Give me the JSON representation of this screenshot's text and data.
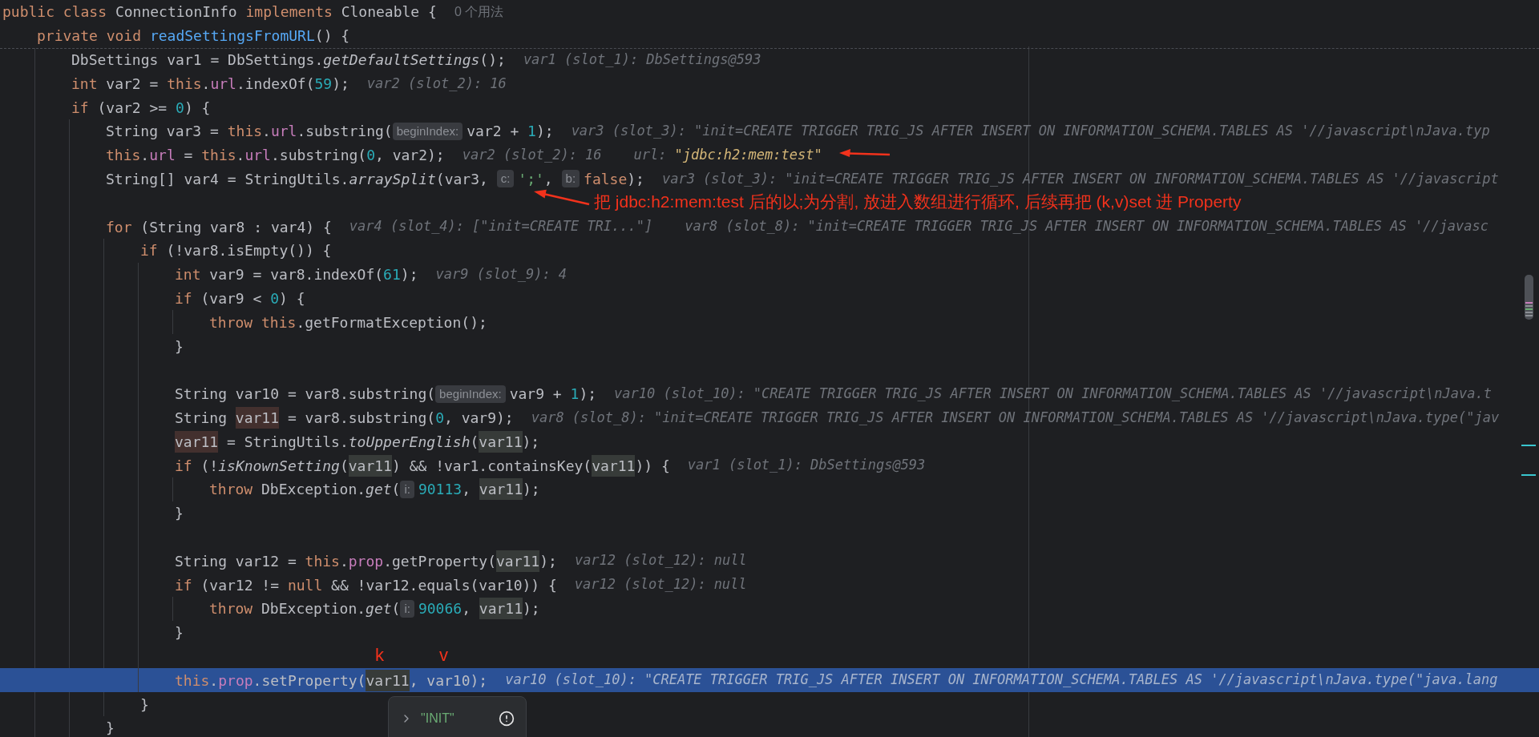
{
  "code": {
    "lines": [
      {
        "selected": false,
        "usages": "0 个用法",
        "tokens": [
          {
            "kind": "k",
            "text": "public class "
          },
          {
            "kind": "p",
            "text": "ConnectionInfo "
          },
          {
            "kind": "k",
            "text": "implements "
          },
          {
            "kind": "p",
            "text": "Cloneable {"
          }
        ],
        "children": [
          {
            "selected": false,
            "tokens": [
              {
                "kind": "k",
                "text": "private void "
              },
              {
                "kind": "d",
                "text": "readSettingsFromURL"
              },
              {
                "kind": "p",
                "text": "() {"
              }
            ],
            "children": [
              {
                "selected": false,
                "tokens": [
                  {
                    "kind": "p",
                    "text": "DbSettings var1 = DbSettings."
                  },
                  {
                    "kind": "i",
                    "text": "getDefaultSettings"
                  },
                  {
                    "kind": "p",
                    "text": "();"
                  }
                ],
                "values": [
                  {
                    "label": "var1 (slot_1):",
                    "value": "DbSettings@593",
                    "changed": false
                  }
                ]
              },
              {
                "selected": false,
                "tokens": [
                  {
                    "kind": "k",
                    "text": "int "
                  },
                  {
                    "kind": "p",
                    "text": "var2 = "
                  },
                  {
                    "kind": "k",
                    "text": "this"
                  },
                  {
                    "kind": "p",
                    "text": "."
                  },
                  {
                    "kind": "f",
                    "text": "url"
                  },
                  {
                    "kind": "p",
                    "text": ".indexOf("
                  },
                  {
                    "kind": "n",
                    "text": "59"
                  },
                  {
                    "kind": "p",
                    "text": ");"
                  }
                ],
                "values": [
                  {
                    "label": "var2 (slot_2):",
                    "value": "16",
                    "changed": false
                  }
                ]
              },
              {
                "selected": false,
                "tokens": [
                  {
                    "kind": "k",
                    "text": "if "
                  },
                  {
                    "kind": "p",
                    "text": "(var2 >= "
                  },
                  {
                    "kind": "n",
                    "text": "0"
                  },
                  {
                    "kind": "p",
                    "text": ") {"
                  }
                ],
                "children": [
                  {
                    "selected": false,
                    "tokens": [
                      {
                        "kind": "p",
                        "text": "String var3 = "
                      },
                      {
                        "kind": "k",
                        "text": "this"
                      },
                      {
                        "kind": "p",
                        "text": "."
                      },
                      {
                        "kind": "f",
                        "text": "url"
                      },
                      {
                        "kind": "p",
                        "text": ".substring("
                      },
                      {
                        "kind": "h",
                        "text": "beginIndex:"
                      },
                      {
                        "kind": "p",
                        "text": "var2 + "
                      },
                      {
                        "kind": "n",
                        "text": "1"
                      },
                      {
                        "kind": "p",
                        "text": ");"
                      }
                    ],
                    "values": [
                      {
                        "label": "var3 (slot_3):",
                        "value": "\"init=CREATE TRIGGER TRIG_JS AFTER INSERT ON INFORMATION_SCHEMA.TABLES AS '//javascript\\nJava.typ",
                        "changed": false
                      }
                    ]
                  },
                  {
                    "selected": false,
                    "tokens": [
                      {
                        "kind": "k",
                        "text": "this"
                      },
                      {
                        "kind": "p",
                        "text": "."
                      },
                      {
                        "kind": "f",
                        "text": "url"
                      },
                      {
                        "kind": "p",
                        "text": " = "
                      },
                      {
                        "kind": "k",
                        "text": "this"
                      },
                      {
                        "kind": "p",
                        "text": "."
                      },
                      {
                        "kind": "f",
                        "text": "url"
                      },
                      {
                        "kind": "p",
                        "text": ".substring("
                      },
                      {
                        "kind": "n",
                        "text": "0"
                      },
                      {
                        "kind": "p",
                        "text": ", var2);"
                      }
                    ],
                    "values": [
                      {
                        "label": "var2 (slot_2):",
                        "value": "16",
                        "changed": false
                      },
                      {
                        "label": "url:",
                        "value": "\"jdbc:h2:mem:test\"",
                        "changed": true
                      }
                    ]
                  },
                  {
                    "selected": false,
                    "tokens": [
                      {
                        "kind": "p",
                        "text": "String[] var4 = StringUtils."
                      },
                      {
                        "kind": "i",
                        "text": "arraySplit"
                      },
                      {
                        "kind": "p",
                        "text": "(var3, "
                      },
                      {
                        "kind": "h",
                        "text": "c:"
                      },
                      {
                        "kind": "s",
                        "text": "';'"
                      },
                      {
                        "kind": "p",
                        "text": ", "
                      },
                      {
                        "kind": "h",
                        "text": "b:"
                      },
                      {
                        "kind": "k",
                        "text": "false"
                      },
                      {
                        "kind": "p",
                        "text": ");"
                      }
                    ],
                    "values": [
                      {
                        "label": "var3 (slot_3):",
                        "value": "\"init=CREATE TRIGGER TRIG_JS AFTER INSERT ON INFORMATION_SCHEMA.TABLES AS '//javascript",
                        "changed": false
                      }
                    ]
                  },
                  {
                    "selected": false
                  },
                  {
                    "selected": false,
                    "tokens": [
                      {
                        "kind": "k",
                        "text": "for "
                      },
                      {
                        "kind": "p",
                        "text": "(String var8 : var4) {"
                      }
                    ],
                    "values": [
                      {
                        "label": "var4 (slot_4):",
                        "value": "[\"init=CREATE TRI...\"]",
                        "changed": false
                      },
                      {
                        "label": "var8 (slot_8):",
                        "value": "\"init=CREATE TRIGGER TRIG_JS AFTER INSERT ON INFORMATION_SCHEMA.TABLES AS '//javasc",
                        "changed": false
                      }
                    ],
                    "children": [
                      {
                        "selected": false,
                        "tokens": [
                          {
                            "kind": "k",
                            "text": "if "
                          },
                          {
                            "kind": "p",
                            "text": "(!var8.isEmpty()) {"
                          }
                        ],
                        "children": [
                          {
                            "selected": false,
                            "tokens": [
                              {
                                "kind": "k",
                                "text": "int "
                              },
                              {
                                "kind": "p",
                                "text": "var9 = var8.indexOf("
                              },
                              {
                                "kind": "n",
                                "text": "61"
                              },
                              {
                                "kind": "p",
                                "text": ");"
                              }
                            ],
                            "values": [
                              {
                                "label": "var9 (slot_9):",
                                "value": "4",
                                "changed": false
                              }
                            ]
                          },
                          {
                            "selected": false,
                            "tokens": [
                              {
                                "kind": "k",
                                "text": "if "
                              },
                              {
                                "kind": "p",
                                "text": "(var9 < "
                              },
                              {
                                "kind": "n",
                                "text": "0"
                              },
                              {
                                "kind": "p",
                                "text": ") {"
                              }
                            ],
                            "children": [
                              {
                                "selected": false,
                                "tokens": [
                                  {
                                    "kind": "k",
                                    "text": "throw "
                                  },
                                  {
                                    "kind": "k",
                                    "text": "this"
                                  },
                                  {
                                    "kind": "p",
                                    "text": ".getFormatException();"
                                  }
                                ]
                              }
                            ]
                          },
                          {
                            "selected": false,
                            "tokens": [
                              {
                                "kind": "p",
                                "text": "}"
                              }
                            ]
                          },
                          {
                            "selected": false
                          },
                          {
                            "selected": false,
                            "tokens": [
                              {
                                "kind": "p",
                                "text": "String var10 = var8.substring("
                              },
                              {
                                "kind": "h",
                                "text": "beginIndex:"
                              },
                              {
                                "kind": "p",
                                "text": "var9 + "
                              },
                              {
                                "kind": "n",
                                "text": "1"
                              },
                              {
                                "kind": "p",
                                "text": ");"
                              }
                            ],
                            "values": [
                              {
                                "label": "var10 (slot_10):",
                                "value": "\"CREATE TRIGGER TRIG_JS AFTER INSERT ON INFORMATION_SCHEMA.TABLES AS '//javascript\\nJava.t",
                                "changed": false
                              }
                            ]
                          },
                          {
                            "selected": false,
                            "tokens": [
                              {
                                "kind": "p",
                                "text": "String "
                              },
                              {
                                "kind": "w",
                                "text": "var11"
                              },
                              {
                                "kind": "p",
                                "text": " = var8.substring("
                              },
                              {
                                "kind": "n",
                                "text": "0"
                              },
                              {
                                "kind": "p",
                                "text": ", var9);"
                              }
                            ],
                            "values": [
                              {
                                "label": "var8 (slot_8):",
                                "value": "\"init=CREATE TRIGGER TRIG_JS AFTER INSERT ON INFORMATION_SCHEMA.TABLES AS '//javascript\\nJava.type(\"jav",
                                "changed": false
                              }
                            ]
                          },
                          {
                            "selected": false,
                            "tokens": [
                              {
                                "kind": "w",
                                "text": "var11"
                              },
                              {
                                "kind": "p",
                                "text": " = StringUtils."
                              },
                              {
                                "kind": "i",
                                "text": "toUpperEnglish"
                              },
                              {
                                "kind": "p",
                                "text": "("
                              },
                              {
                                "kind": "r",
                                "text": "var11"
                              },
                              {
                                "kind": "p",
                                "text": ");"
                              }
                            ]
                          },
                          {
                            "selected": false,
                            "tokens": [
                              {
                                "kind": "k",
                                "text": "if "
                              },
                              {
                                "kind": "p",
                                "text": "(!"
                              },
                              {
                                "kind": "i",
                                "text": "isKnownSetting"
                              },
                              {
                                "kind": "p",
                                "text": "("
                              },
                              {
                                "kind": "r",
                                "text": "var11"
                              },
                              {
                                "kind": "p",
                                "text": ") && !var1.containsKey("
                              },
                              {
                                "kind": "r",
                                "text": "var11"
                              },
                              {
                                "kind": "p",
                                "text": ")) {"
                              }
                            ],
                            "values": [
                              {
                                "label": "var1 (slot_1):",
                                "value": "DbSettings@593",
                                "changed": false
                              }
                            ],
                            "children": [
                              {
                                "selected": false,
                                "tokens": [
                                  {
                                    "kind": "k",
                                    "text": "throw "
                                  },
                                  {
                                    "kind": "p",
                                    "text": "DbException."
                                  },
                                  {
                                    "kind": "i",
                                    "text": "get"
                                  },
                                  {
                                    "kind": "p",
                                    "text": "("
                                  },
                                  {
                                    "kind": "h",
                                    "text": "i:"
                                  },
                                  {
                                    "kind": "n",
                                    "text": "90113"
                                  },
                                  {
                                    "kind": "p",
                                    "text": ", "
                                  },
                                  {
                                    "kind": "r",
                                    "text": "var11"
                                  },
                                  {
                                    "kind": "p",
                                    "text": ");"
                                  }
                                ]
                              }
                            ]
                          },
                          {
                            "selected": false,
                            "tokens": [
                              {
                                "kind": "p",
                                "text": "}"
                              }
                            ]
                          },
                          {
                            "selected": false
                          },
                          {
                            "selected": false,
                            "tokens": [
                              {
                                "kind": "p",
                                "text": "String var12 = "
                              },
                              {
                                "kind": "k",
                                "text": "this"
                              },
                              {
                                "kind": "p",
                                "text": "."
                              },
                              {
                                "kind": "f",
                                "text": "prop"
                              },
                              {
                                "kind": "p",
                                "text": ".getProperty("
                              },
                              {
                                "kind": "r",
                                "text": "var11"
                              },
                              {
                                "kind": "p",
                                "text": ");"
                              }
                            ],
                            "values": [
                              {
                                "label": "var12 (slot_12):",
                                "value": "null",
                                "changed": false
                              }
                            ]
                          },
                          {
                            "selected": false,
                            "tokens": [
                              {
                                "kind": "k",
                                "text": "if "
                              },
                              {
                                "kind": "p",
                                "text": "(var12 != "
                              },
                              {
                                "kind": "k",
                                "text": "null"
                              },
                              {
                                "kind": "p",
                                "text": " && !var12.equals(var10)) {"
                              }
                            ],
                            "values": [
                              {
                                "label": "var12 (slot_12):",
                                "value": "null",
                                "changed": false
                              }
                            ],
                            "children": [
                              {
                                "selected": false,
                                "tokens": [
                                  {
                                    "kind": "k",
                                    "text": "throw "
                                  },
                                  {
                                    "kind": "p",
                                    "text": "DbException."
                                  },
                                  {
                                    "kind": "i",
                                    "text": "get"
                                  },
                                  {
                                    "kind": "p",
                                    "text": "("
                                  },
                                  {
                                    "kind": "h",
                                    "text": "i:"
                                  },
                                  {
                                    "kind": "n",
                                    "text": "90066"
                                  },
                                  {
                                    "kind": "p",
                                    "text": ", "
                                  },
                                  {
                                    "kind": "r",
                                    "text": "var11"
                                  },
                                  {
                                    "kind": "p",
                                    "text": ");"
                                  }
                                ]
                              }
                            ]
                          },
                          {
                            "selected": false,
                            "tokens": [
                              {
                                "kind": "p",
                                "text": "}"
                              }
                            ]
                          },
                          {
                            "selected": false
                          },
                          {
                            "selected": true,
                            "tokens": [
                              {
                                "kind": "k",
                                "text": "this"
                              },
                              {
                                "kind": "p",
                                "text": "."
                              },
                              {
                                "kind": "f",
                                "text": "prop"
                              },
                              {
                                "kind": "p",
                                "text": ".setProperty("
                              },
                              {
                                "kind": "r",
                                "text": "var11"
                              },
                              {
                                "kind": "p",
                                "text": ", var10);"
                              }
                            ],
                            "values": [
                              {
                                "label": "var10 (slot_10):",
                                "value": "\"CREATE TRIGGER TRIG_JS AFTER INSERT ON INFORMATION_SCHEMA.TABLES AS '//javascript\\nJava.type(\"java.lang",
                                "changed": false
                              }
                            ]
                          }
                        ]
                      },
                      {
                        "selected": false,
                        "tokens": [
                          {
                            "kind": "p",
                            "text": "}"
                          }
                        ]
                      }
                    ]
                  },
                  {
                    "selected": false,
                    "tokens": [
                      {
                        "kind": "p",
                        "text": "}"
                      }
                    ]
                  }
                ]
              }
            ]
          }
        ]
      }
    ]
  },
  "annotations": [
    {
      "kind": "note",
      "text": "把 jdbc:h2:mem:test 后的以;为分割, 放进入数组进行循环, 后续再把 (k,v)set 进 Property"
    },
    {
      "kind": "letter",
      "text": "k"
    },
    {
      "kind": "letter",
      "text": "v"
    }
  ],
  "popup": {
    "value": "\"INIT\""
  }
}
